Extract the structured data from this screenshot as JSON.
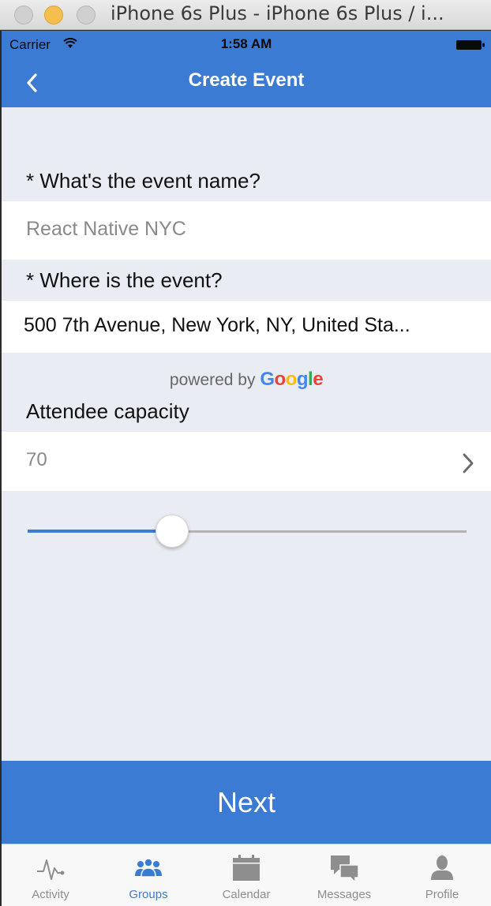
{
  "window": {
    "title": "iPhone 6s Plus - iPhone 6s Plus / i..."
  },
  "status_bar": {
    "carrier": "Carrier",
    "time": "1:58 AM"
  },
  "nav": {
    "title": "Create Event"
  },
  "form": {
    "event_name_label": "* What's the event name?",
    "event_name_placeholder": "React Native NYC",
    "location_label": "* Where is the event?",
    "location_value": "500 7th Avenue, New York, NY, United Sta...",
    "powered_by": "powered by",
    "google_letters": [
      "G",
      "o",
      "o",
      "g",
      "l",
      "e"
    ],
    "capacity_label": "Attendee capacity",
    "capacity_value": "70",
    "slider_fraction": 0.33
  },
  "next_label": "Next",
  "tabs": [
    {
      "label": "Activity",
      "icon": "activity-icon",
      "active": false
    },
    {
      "label": "Groups",
      "icon": "groups-icon",
      "active": true
    },
    {
      "label": "Calendar",
      "icon": "calendar-icon",
      "active": false
    },
    {
      "label": "Messages",
      "icon": "messages-icon",
      "active": false
    },
    {
      "label": "Profile",
      "icon": "profile-icon",
      "active": false
    }
  ],
  "colors": {
    "accent": "#3c7bd4",
    "background": "#e9edf3",
    "tab_inactive": "#8e8e8e"
  }
}
